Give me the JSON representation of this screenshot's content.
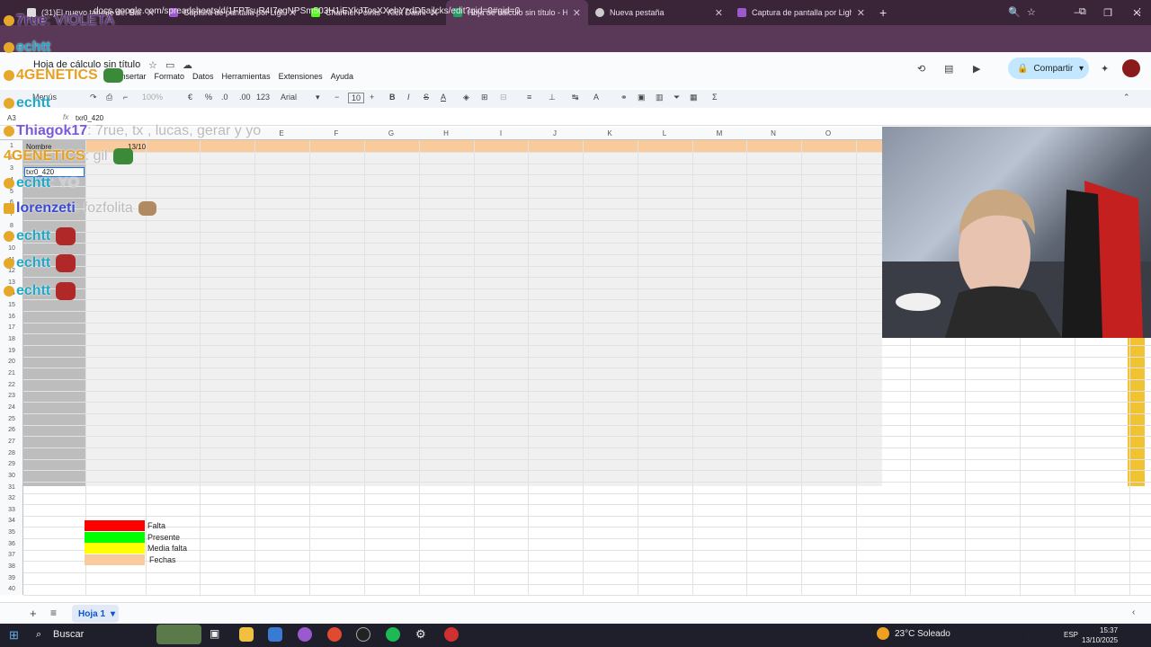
{
  "browser": {
    "tabs": [
      {
        "title": "(31)El nuevo tatuaje del Baulo",
        "color": "#e8e8e8"
      },
      {
        "title": "Captura de pantalla por Lightsh",
        "color": "#9b59d0"
      },
      {
        "title": "Channel Points - Kick Dashboar",
        "color": "#53fc18"
      },
      {
        "title": "Hoja de cálculo sin título - Hoja",
        "color": "#1ea362"
      },
      {
        "title": "Nueva pestaña",
        "color": "#dddddd"
      },
      {
        "title": "Captura de pantalla por Lightsh",
        "color": "#9b59d0"
      }
    ],
    "new_tab": "+",
    "url": "docs.google.com/spreadsheets/d/1FPTsuR4I7egNPSm503H1iEYkJTosXXebYzdD5ajlcks/edit?gid=0#gid=0"
  },
  "doc": {
    "title": "Hoja de cálculo sin título",
    "menus": [
      "Insertar",
      "Formato",
      "Datos",
      "Herramientas",
      "Extensiones",
      "Ayuda"
    ],
    "share_label": "Compartir"
  },
  "toolbar": {
    "menus": "Menús",
    "zoom": "100%",
    "currency": "€",
    "percent": "%",
    "dec_less": ".0",
    "dec_more": ".00",
    "number_format": "123",
    "font": "Arial",
    "font_size": "10"
  },
  "formula": {
    "cell_ref": "A3",
    "value": "txr0_420"
  },
  "grid": {
    "columns": [
      "E",
      "F",
      "G",
      "H",
      "I",
      "J",
      "K",
      "L",
      "M",
      "N",
      "O"
    ],
    "rows": [
      "1",
      "2",
      "3",
      "4",
      "5",
      "6",
      "7",
      "8",
      "9",
      "10",
      "11",
      "12",
      "13",
      "14",
      "15",
      "16",
      "17",
      "18",
      "19",
      "20",
      "21",
      "22",
      "23",
      "24",
      "25",
      "26",
      "27",
      "28",
      "29",
      "30",
      "31",
      "32",
      "33",
      "34",
      "35",
      "36",
      "37",
      "38",
      "39",
      "40"
    ],
    "a1": "Nombre",
    "b1": "13/10",
    "a3": "txr0_420",
    "colors": {
      "header_row": "#f9cb9c",
      "name_col": "#bdbdbd",
      "weekend_col": "#f1c232"
    }
  },
  "legend": [
    {
      "label": "Falta",
      "color": "#ff0000"
    },
    {
      "label": "Presente",
      "color": "#00ff00"
    },
    {
      "label": "Media falta",
      "color": "#ffff00"
    },
    {
      "label": "Fechas",
      "color": "#f9cb9c"
    }
  ],
  "sheet": {
    "tab": "Hoja 1",
    "add": "+",
    "all": "≡"
  },
  "chat": [
    {
      "user": "7rue",
      "msg": ": VIOLETA",
      "color": "#5a2d82"
    },
    {
      "user": "echtt",
      "msg": "",
      "color": "#20a8c8"
    },
    {
      "user": "4GENETICS",
      "msg": "",
      "color": "#e8a020"
    },
    {
      "user": "echtt",
      "msg": "",
      "color": "#20a8c8"
    },
    {
      "user": "Thiagok17",
      "msg": ": 7rue, tx , lucas, gerar y yo",
      "color": "#7a5ad8"
    },
    {
      "user": "4GENETICS",
      "msg": ": gil",
      "color": "#e8a020"
    },
    {
      "user": "echtt",
      "msg": ": YO",
      "color": "#20a8c8"
    },
    {
      "user": "lorenzeti",
      "msg": ": fozfolita",
      "color": "#3b4ad0"
    },
    {
      "user": "echtt",
      "msg": "",
      "color": "#20a8c8"
    },
    {
      "user": "echtt",
      "msg": "",
      "color": "#20a8c8"
    },
    {
      "user": "echtt",
      "msg": "",
      "color": "#20a8c8"
    }
  ],
  "taskbar": {
    "search": "Buscar",
    "weather": "23°C  Soleado",
    "lang": "ESP",
    "time": "15:37",
    "date": "13/10/2025"
  }
}
